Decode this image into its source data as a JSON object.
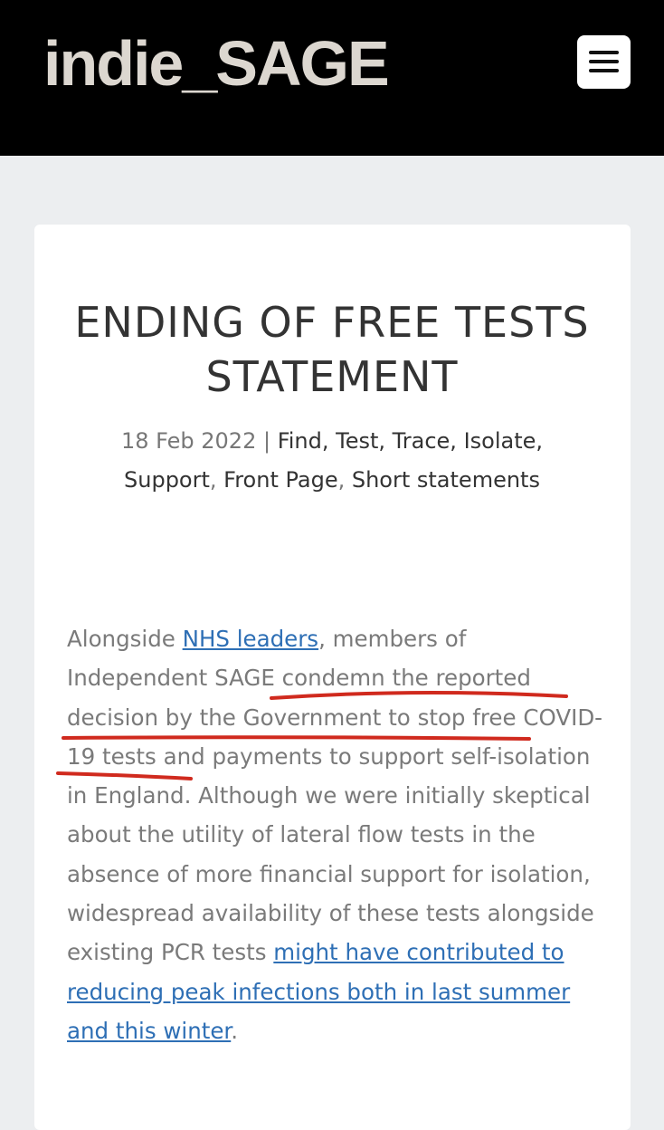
{
  "header": {
    "logo": "indie_SAGE",
    "menu_icon": "hamburger-menu-icon",
    "bg_color": "#000000"
  },
  "article": {
    "title_line1": "ENDING OF FREE TESTS",
    "title_line2": "STATEMENT",
    "date": "18 Feb 2022",
    "separator": " | ",
    "categories": [
      "Find, Test, Trace, Isolate, Support",
      "Front Page",
      "Short statements"
    ],
    "category_separator": ", ",
    "body": {
      "p1_part1": "Alongside ",
      "link1": "NHS leaders",
      "p1_part2": ", members of Independent SAGE condemn the reported decision by the Government to stop free COVID-19 tests and payments to support self-isolation in England. Although we were initially skeptical about the utility of lateral flow tests in the absence of more financial support for isolation, widespread availability of these tests alongside existing PCR tests ",
      "link2": "might have contributed to reducing peak infections both in last summer and this winter",
      "p1_end": "."
    }
  },
  "colors": {
    "link": "#2e6fb5",
    "annotation": "#d02a1e",
    "page_bg": "#eceef0"
  }
}
